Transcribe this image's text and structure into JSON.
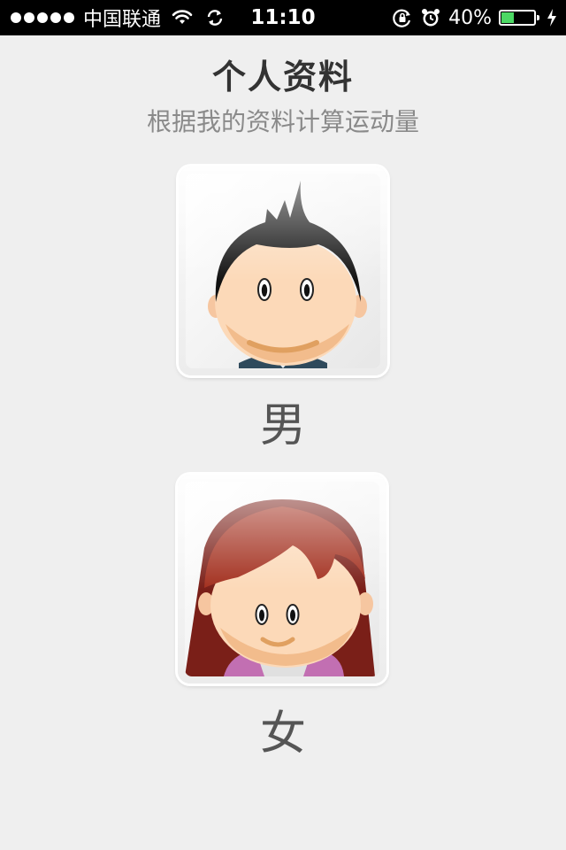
{
  "status_bar": {
    "carrier": "中国联通",
    "time": "11:10",
    "battery_text": "40%",
    "battery_level": 0.4,
    "battery_color": "#4cd964",
    "icons": [
      "signal-dots",
      "wifi-icon",
      "sync-icon",
      "rotation-lock-icon",
      "alarm-icon",
      "battery-icon",
      "charging-bolt-icon"
    ]
  },
  "header": {
    "title": "个人资料",
    "subtitle": "根据我的资料计算运动量"
  },
  "genders": [
    {
      "label": "男",
      "avatar": "male-avatar"
    },
    {
      "label": "女",
      "avatar": "female-avatar"
    }
  ],
  "colors": {
    "background": "#efefef",
    "title": "#333333",
    "subtitle": "#8a8a8a",
    "label": "#555555"
  }
}
